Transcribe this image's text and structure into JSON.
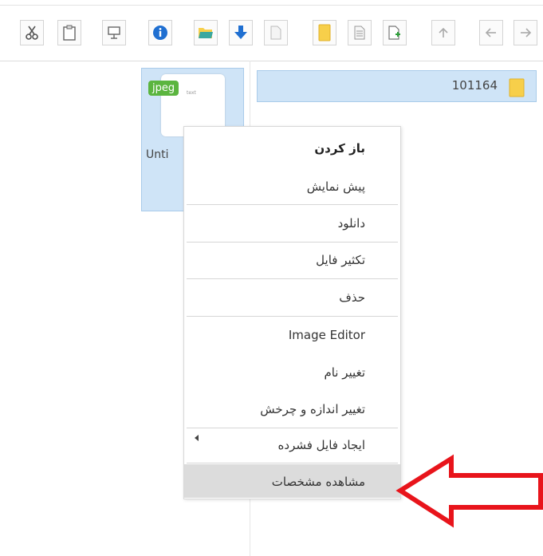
{
  "toolbar": {
    "buttons": [
      {
        "icon": "cut-icon"
      },
      {
        "icon": "paste-icon"
      },
      {
        "icon": "presentation-icon"
      },
      {
        "icon": "info-icon"
      },
      {
        "icon": "folder-open-icon"
      },
      {
        "icon": "download-icon"
      },
      {
        "icon": "blank-file-icon"
      },
      {
        "icon": "new-folder-icon"
      },
      {
        "icon": "text-file-icon"
      },
      {
        "icon": "new-file-icon"
      },
      {
        "icon": "up-arrow-icon"
      },
      {
        "icon": "back-arrow-icon"
      },
      {
        "icon": "forward-arrow-icon"
      }
    ]
  },
  "file": {
    "badge": "jpeg",
    "ext_small": "text",
    "name": "Unti"
  },
  "folder": {
    "name": "101164"
  },
  "context_menu": {
    "items": [
      "باز کردن",
      "پیش نمایش",
      "دانلود",
      "تکثیر فایل",
      "حذف",
      "Image Editor",
      "تغییر نام",
      "تغییر اندازه و چرخش",
      "ایجاد فایل فشرده",
      "مشاهده مشخصات"
    ]
  },
  "colors": {
    "selection": "#cfe4f7",
    "badge": "#5bb53f",
    "annotation_arrow": "#e8141b",
    "folder": "#f7cf4a",
    "info": "#1f6fd1"
  }
}
